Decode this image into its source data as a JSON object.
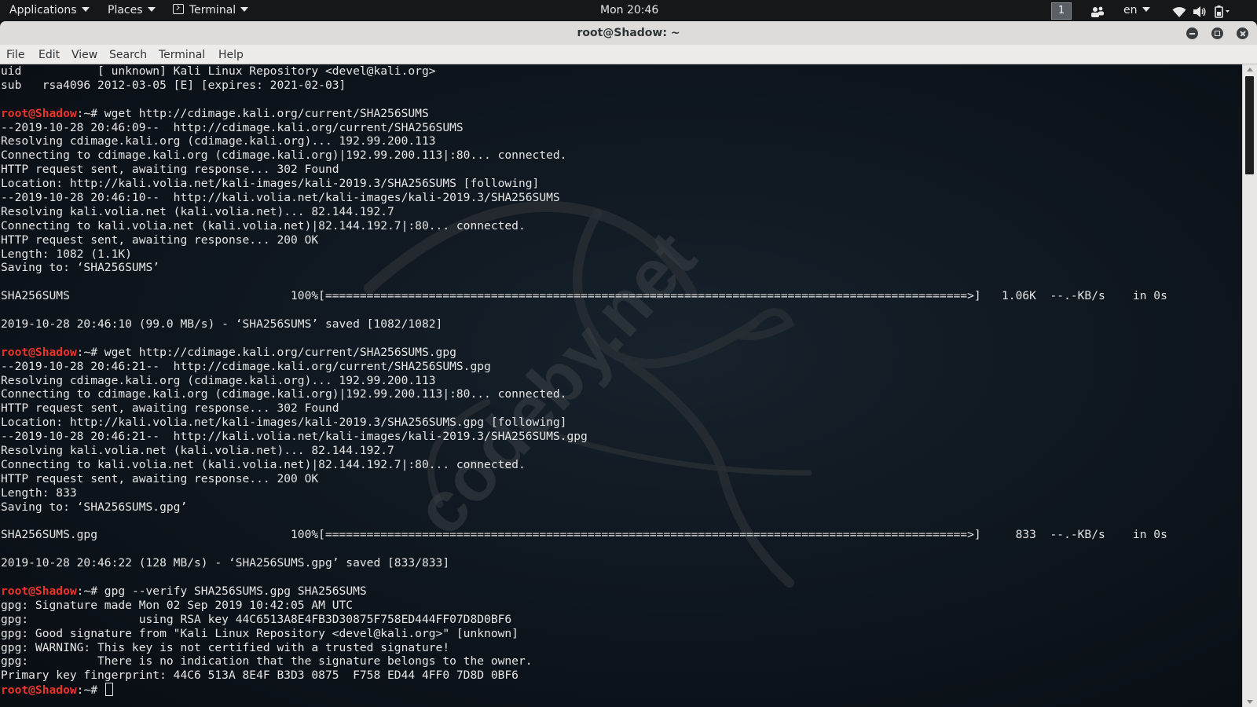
{
  "panel": {
    "applications": "Applications",
    "places": "Places",
    "terminal": "Terminal",
    "clock": "Mon 20:46",
    "workspace": "1",
    "lang": "en"
  },
  "window": {
    "title": "root@Shadow: ~"
  },
  "menu": [
    "File",
    "Edit",
    "View",
    "Search",
    "Terminal",
    "Help"
  ],
  "terminal": {
    "prompt": "root@Shadow",
    "lines": [
      "uid           [ unknown] Kali Linux Repository <devel@kali.org>",
      "sub   rsa4096 2012-03-05 [E] [expires: 2021-02-03]",
      "",
      {
        "prompt": "root@Shadow",
        "cmd": ":~# wget http://cdimage.kali.org/current/SHA256SUMS"
      },
      "--2019-10-28 20:46:09--  http://cdimage.kali.org/current/SHA256SUMS",
      "Resolving cdimage.kali.org (cdimage.kali.org)... 192.99.200.113",
      "Connecting to cdimage.kali.org (cdimage.kali.org)|192.99.200.113|:80... connected.",
      "HTTP request sent, awaiting response... 302 Found",
      "Location: http://kali.volia.net/kali-images/kali-2019.3/SHA256SUMS [following]",
      "--2019-10-28 20:46:10--  http://kali.volia.net/kali-images/kali-2019.3/SHA256SUMS",
      "Resolving kali.volia.net (kali.volia.net)... 82.144.192.7",
      "Connecting to kali.volia.net (kali.volia.net)|82.144.192.7|:80... connected.",
      "HTTP request sent, awaiting response... 200 OK",
      "Length: 1082 (1.1K)",
      "Saving to: ‘SHA256SUMS’",
      "",
      "SHA256SUMS                                100%[=============================================================================================>]   1.06K  --.-KB/s    in 0s",
      "",
      "2019-10-28 20:46:10 (99.0 MB/s) - ‘SHA256SUMS’ saved [1082/1082]",
      "",
      {
        "prompt": "root@Shadow",
        "cmd": ":~# wget http://cdimage.kali.org/current/SHA256SUMS.gpg"
      },
      "--2019-10-28 20:46:21--  http://cdimage.kali.org/current/SHA256SUMS.gpg",
      "Resolving cdimage.kali.org (cdimage.kali.org)... 192.99.200.113",
      "Connecting to cdimage.kali.org (cdimage.kali.org)|192.99.200.113|:80... connected.",
      "HTTP request sent, awaiting response... 302 Found",
      "Location: http://kali.volia.net/kali-images/kali-2019.3/SHA256SUMS.gpg [following]",
      "--2019-10-28 20:46:21--  http://kali.volia.net/kali-images/kali-2019.3/SHA256SUMS.gpg",
      "Resolving kali.volia.net (kali.volia.net)... 82.144.192.7",
      "Connecting to kali.volia.net (kali.volia.net)|82.144.192.7|:80... connected.",
      "HTTP request sent, awaiting response... 200 OK",
      "Length: 833",
      "Saving to: ‘SHA256SUMS.gpg’",
      "",
      "SHA256SUMS.gpg                            100%[=============================================================================================>]     833  --.-KB/s    in 0s",
      "",
      "2019-10-28 20:46:22 (128 MB/s) - ‘SHA256SUMS.gpg’ saved [833/833]",
      "",
      {
        "prompt": "root@Shadow",
        "cmd": ":~# gpg --verify SHA256SUMS.gpg SHA256SUMS"
      },
      "gpg: Signature made Mon 02 Sep 2019 10:42:05 AM UTC",
      "gpg:                using RSA key 44C6513A8E4FB3D30875F758ED444FF07D8D0BF6",
      "gpg: Good signature from \"Kali Linux Repository <devel@kali.org>\" [unknown]",
      "gpg: WARNING: This key is not certified with a trusted signature!",
      "gpg:          There is no indication that the signature belongs to the owner.",
      "Primary key fingerprint: 44C6 513A 8E4F B3D3 0875  F758 ED44 4FF0 7D8D 0BF6",
      {
        "prompt": "root@Shadow",
        "cmd": ":~# ",
        "cursor": true
      }
    ]
  },
  "watermark": "codeby.net",
  "icons": {
    "network": "wifi-icon",
    "volume": "volume-icon",
    "power": "power-icon",
    "people": "people-icon"
  },
  "colors": {
    "prompt": "#e8352b",
    "terminal_bg": "#0b1117",
    "text": "#e6e6e6"
  }
}
